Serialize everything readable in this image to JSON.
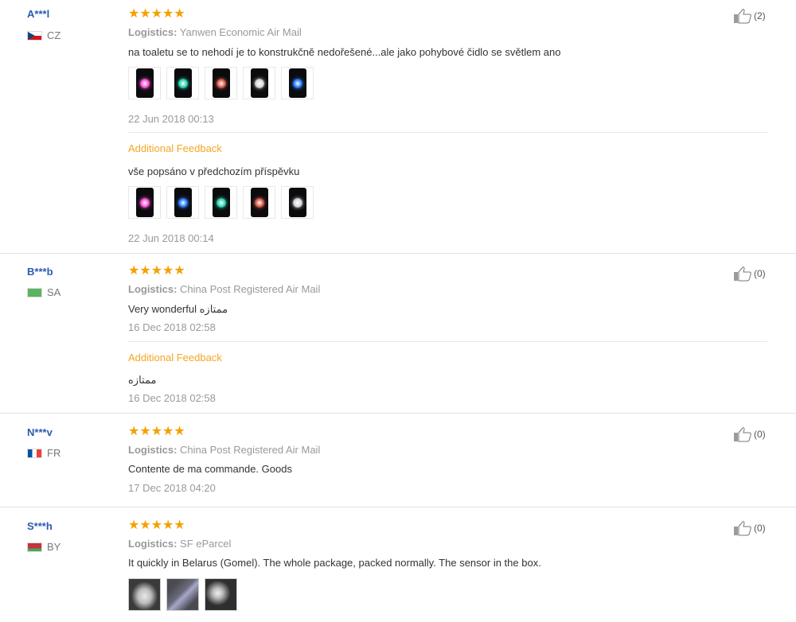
{
  "colors": {
    "accent": "#f4a000",
    "link": "#2a5bb0",
    "feedback": "#f5a623"
  },
  "logistics_label": "Logistics:",
  "reviews": [
    {
      "user": "A***l",
      "country": "CZ",
      "flag": "flag-cz",
      "stars": "★★★★★",
      "rating": 5,
      "logistics": "Yanwen Economic Air Mail",
      "text": "na toaletu se to nehodí je to konstrukčně nedořešené...ale jako pohybové čidlo se světlem ano",
      "date": "22 Jun 2018 00:13",
      "images": [
        {
          "color": "#ff4fd8"
        },
        {
          "color": "#2fd6b0"
        },
        {
          "color": "#d95a4a"
        },
        {
          "color": "#d8d8d8"
        },
        {
          "color": "#2a7dff"
        }
      ],
      "likes": "(2)",
      "additional": {
        "label": "Additional Feedback",
        "text": "vše popsáno v předchozím příspěvku",
        "date": "22 Jun 2018 00:14",
        "images": [
          {
            "color": "#ff4fd8"
          },
          {
            "color": "#2a7dff"
          },
          {
            "color": "#2fd6b0"
          },
          {
            "color": "#d95a4a"
          },
          {
            "color": "#d8d8d8"
          }
        ]
      }
    },
    {
      "user": "B***b",
      "country": "SA",
      "flag": "flag-sa",
      "stars": "★★★★★",
      "rating": 5,
      "logistics": "China Post Registered Air Mail",
      "text": "Very wonderful ممتازه",
      "date": "16 Dec 2018 02:58",
      "likes": "(0)",
      "additional": {
        "label": "Additional Feedback",
        "text": "ممتازه",
        "date": "16 Dec 2018 02:58"
      }
    },
    {
      "user": "N***v",
      "country": "FR",
      "flag": "flag-fr",
      "stars": "★★★★★",
      "rating": 5,
      "logistics": "China Post Registered Air Mail",
      "text": "Contente de ma commande. Goods",
      "date": "17 Dec 2018 04:20",
      "likes": "(0)"
    },
    {
      "user": "S***h",
      "country": "BY",
      "flag": "flag-by",
      "stars": "★★★★★",
      "rating": 5,
      "logistics": "SF eParcel",
      "text": "It quickly in Belarus (Gomel). The whole package, packed normally. The sensor in the box.",
      "likes": "(0)",
      "photos": [
        {
          "color": "#3a3a3a"
        },
        {
          "color": "#4a4a52"
        },
        {
          "color": "#2e2e2e"
        }
      ]
    }
  ]
}
